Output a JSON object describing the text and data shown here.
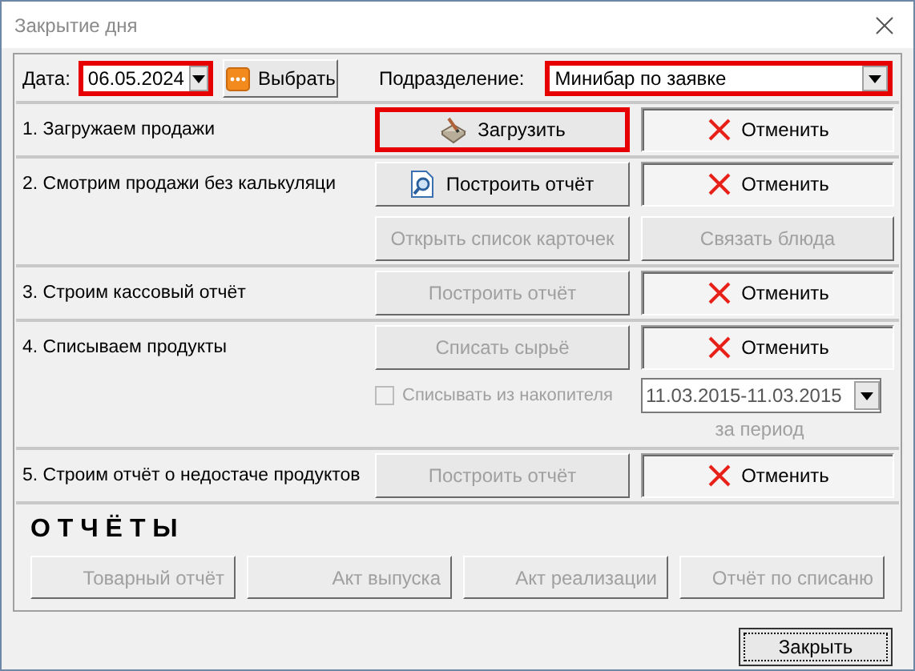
{
  "window": {
    "title": "Закрытие дня"
  },
  "header": {
    "date_label": "Дата:",
    "date": {
      "value": "06.05.2024",
      "highlighted": true
    },
    "choose_button": {
      "label": "Выбрать"
    },
    "department_label": "Подразделение:",
    "department": {
      "value": "Минибар по заявке",
      "highlighted": true
    }
  },
  "steps": [
    {
      "label": "1. Загружаем продажи",
      "buttons": [
        {
          "kind": "load",
          "label": "Загрузить",
          "disabled": false,
          "highlighted": true
        },
        {
          "kind": "cancel",
          "label": "Отменить",
          "disabled": false,
          "highlighted": false
        }
      ]
    },
    {
      "label": "2. Смотрим продажи без калькуляци",
      "buttons": [
        {
          "kind": "report",
          "label": "Построить отчёт",
          "disabled": false,
          "highlighted": false
        },
        {
          "kind": "cancel",
          "label": "Отменить",
          "disabled": false,
          "highlighted": false
        },
        {
          "kind": "plain",
          "label": "Открыть список карточек",
          "disabled": true,
          "highlighted": false
        },
        {
          "kind": "plain",
          "label": "Связать блюда",
          "disabled": true,
          "highlighted": false
        }
      ]
    },
    {
      "label": "3. Строим кассовый отчёт",
      "buttons": [
        {
          "kind": "plain",
          "label": "Построить отчёт",
          "disabled": true,
          "highlighted": false
        },
        {
          "kind": "cancel",
          "label": "Отменить",
          "disabled": false,
          "highlighted": false
        }
      ]
    },
    {
      "label": "4. Списываем продукты",
      "buttons": [
        {
          "kind": "plain",
          "label": "Списать сырьё",
          "disabled": true,
          "highlighted": false
        },
        {
          "kind": "cancel",
          "label": "Отменить",
          "disabled": false,
          "highlighted": false
        }
      ],
      "accumulator": {
        "label": "Списывать из накопителя",
        "checked": false,
        "disabled": true
      },
      "period": {
        "value": "11.03.2015-11.03.2015",
        "caption": "за период"
      }
    },
    {
      "label": "5. Строим отчёт о недостаче продуктов",
      "buttons": [
        {
          "kind": "plain",
          "label": "Построить отчёт",
          "disabled": true,
          "highlighted": false
        },
        {
          "kind": "cancel",
          "label": "Отменить",
          "disabled": false,
          "highlighted": false
        }
      ]
    }
  ],
  "reports": {
    "title": "О Т Ч Ё Т Ы",
    "buttons": [
      {
        "label": "Товарный отчёт",
        "disabled": true
      },
      {
        "label": "Акт выпуска",
        "disabled": true
      },
      {
        "label": "Акт реализации",
        "disabled": true
      },
      {
        "label": "Отчёт по списаню",
        "disabled": true
      }
    ]
  },
  "close_button": {
    "label": "Закрыть"
  }
}
